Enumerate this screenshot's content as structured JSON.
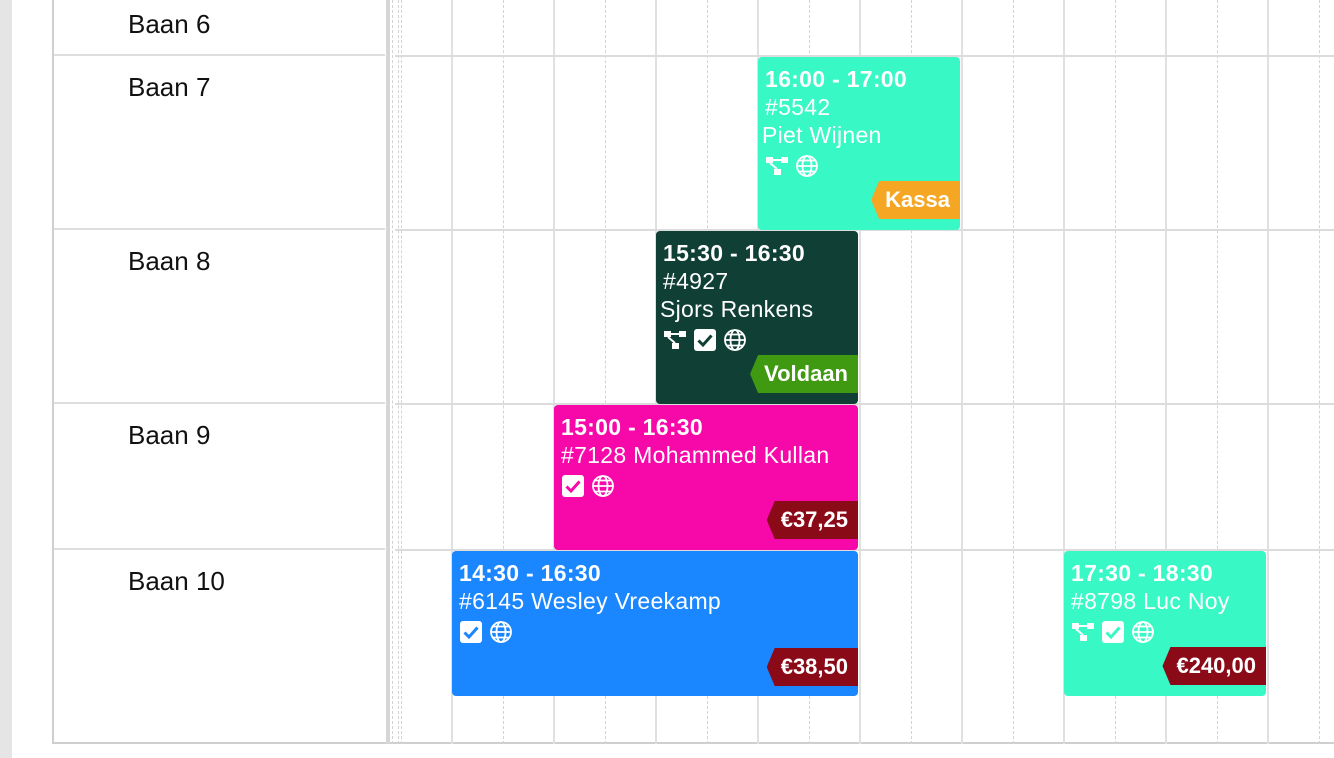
{
  "rows": [
    {
      "label": "Baan 6"
    },
    {
      "label": "Baan 7"
    },
    {
      "label": "Baan 8"
    },
    {
      "label": "Baan 9"
    },
    {
      "label": "Baan 10"
    }
  ],
  "bookings": [
    {
      "time": "16:00 - 17:00",
      "id": "#5542",
      "name": "Piet Wijnen",
      "tag": "Kassa",
      "color": "#38f8c6",
      "tag_color": "#f5a623"
    },
    {
      "time": "15:30 - 16:30",
      "id": "#4927",
      "name": "Sjors Renkens",
      "tag": "Voldaan",
      "color": "#0f3f35",
      "tag_color": "#3f9a12"
    },
    {
      "time": "15:00 - 16:30",
      "id_name": "#7128 Mohammed Kullan",
      "tag": "€37,25",
      "color": "#f708a9",
      "tag_color": "#8a0a18"
    },
    {
      "time": "14:30 - 16:30",
      "id_name": "#6145 Wesley Vreekamp",
      "tag": "€38,50",
      "color": "#1a86ff",
      "tag_color": "#8a0a18"
    },
    {
      "time": "17:30 - 18:30",
      "id_name": "#8798 Luc Noy",
      "tag": "€240,00",
      "color": "#38f8c6",
      "tag_color": "#8a0a18"
    }
  ],
  "icon_names": [
    "flow-icon",
    "check-icon",
    "globe-icon"
  ]
}
